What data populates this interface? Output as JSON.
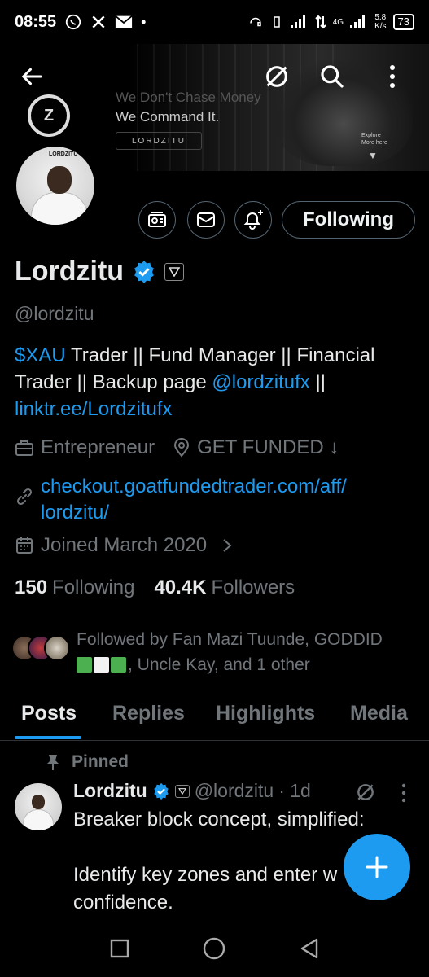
{
  "status_bar": {
    "time": "08:55",
    "battery": "73",
    "net_speed_top": "5.8",
    "net_speed_bottom": "K/s",
    "net_type": "4G"
  },
  "banner": {
    "slogan_line1": "We Don't Chase Money",
    "slogan_line2": "We Command It.",
    "brand": "LORDZITU",
    "explore_line1": "Explore",
    "explore_line2": "More here"
  },
  "avatar": {
    "tag": "LORDZITU"
  },
  "actions": {
    "follow_label": "Following"
  },
  "profile": {
    "name": "Lordzitu",
    "handle": "@lordzitu",
    "bio": {
      "cashtag": "$XAU",
      "text_part1": " Trader || Fund Manager || Financial Trader || Backup page ",
      "mention": "@lordzitufx",
      "text_part2": " ||",
      "link": "linktr.ee/Lordzitufx"
    },
    "profession": "Entrepreneur",
    "location": "GET FUNDED ↓",
    "website_line1": "checkout.goatfundedtrader.com/aff/",
    "website_line2": "lordzitu/",
    "joined": "Joined March 2020"
  },
  "counts": {
    "following_value": "150",
    "following_label": "Following",
    "followers_value": "40.4K",
    "followers_label": "Followers"
  },
  "followed_by": {
    "text_part1": "Followed by Fan Mazi Tuunde, GODDID",
    "text_part2": ", Uncle Kay, and 1 other"
  },
  "tabs": [
    {
      "label": "Posts"
    },
    {
      "label": "Replies"
    },
    {
      "label": "Highlights"
    },
    {
      "label": "Media"
    }
  ],
  "post": {
    "pinned_label": "Pinned",
    "author_name": "Lordzitu",
    "author_handle": "@lordzitu",
    "time": " · 1d",
    "line1": "Breaker block concept, simplified:",
    "line2": "Identify key zones and enter w",
    "line3": "confidence."
  },
  "colors": {
    "accent": "#1d9bf0",
    "muted_text": "#71767b",
    "main_text": "#e7e9ea",
    "border": "#536471",
    "background": "#000000",
    "emoji_green": "#4caf50",
    "emoji_white": "#f2f2f2"
  },
  "icons": {
    "back": "arrow-left-icon",
    "grok": "grok-icon",
    "search": "search-icon",
    "more": "more-vertical-icon",
    "subscribe": "subscription-icon",
    "message": "mail-icon",
    "notify": "bell-plus-icon",
    "verified": "verified-badge-icon",
    "profession": "briefcase-icon",
    "location": "location-pin-icon",
    "link": "link-icon",
    "calendar": "calendar-icon",
    "pin": "pin-icon"
  }
}
